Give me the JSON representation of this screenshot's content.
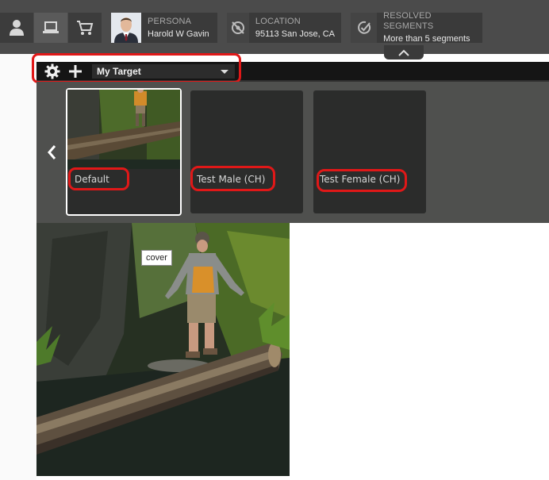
{
  "toolbar": {
    "devices": [
      {
        "icon": "user-icon",
        "active": false
      },
      {
        "icon": "laptop-icon",
        "active": true
      },
      {
        "icon": "cart-icon",
        "active": false
      }
    ],
    "persona": {
      "label": "PERSONA",
      "value": "Harold W Gavin",
      "icon": "avatar"
    },
    "location": {
      "label": "LOCATION",
      "value": "95113 San Jose, CA",
      "icon": "location-off-icon"
    },
    "segments": {
      "label": "RESOLVED SEGMENTS",
      "value": "More than 5 segments",
      "icon": "target-check-icon"
    },
    "collapse_icon": "chevron-up-icon"
  },
  "editor": {
    "settings_icon": "gear-icon",
    "add_icon": "plus-icon",
    "target_select": {
      "value": "My Target",
      "icon": "caret-down-icon"
    }
  },
  "experiences": {
    "prev_icon": "chevron-left-icon",
    "items": [
      {
        "name": "Default",
        "selected": true
      },
      {
        "name": "Test Male (CH)",
        "selected": false
      },
      {
        "name": "Test Female (CH)",
        "selected": false
      }
    ]
  },
  "content": {
    "tooltip": "cover"
  },
  "colors": {
    "toolbar_bg": "#4b4b4b",
    "editor_bar_bg": "#151515",
    "panel_bg": "#4f504e",
    "card_bg": "#2b2c2b",
    "annotation_red": "#e01818"
  }
}
